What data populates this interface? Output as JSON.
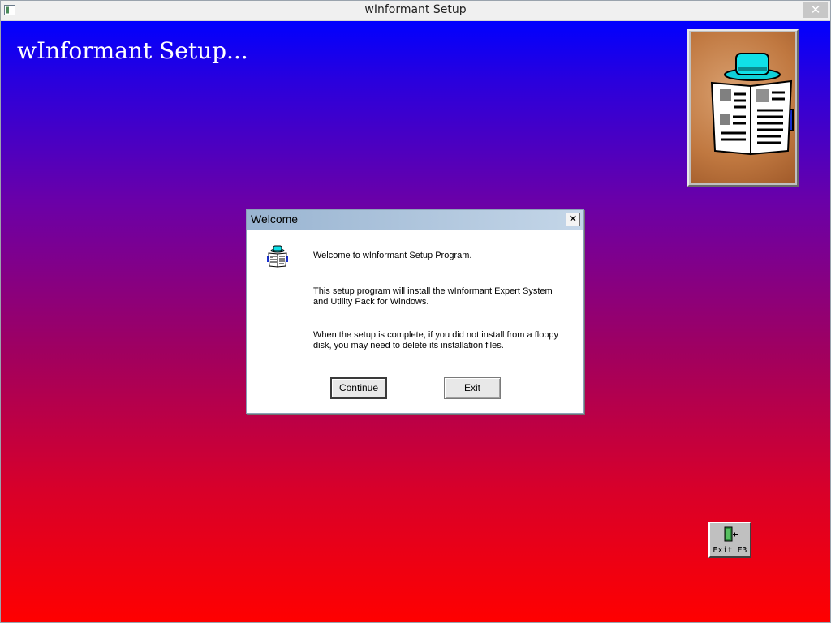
{
  "window": {
    "title": "wInformant Setup",
    "close_label": "✕",
    "app_icon": "window-app-icon"
  },
  "desktop": {
    "heading": "wInformant Setup...",
    "logo": "newspaper-reader-logo",
    "background_top_color": "#0000ff",
    "background_bottom_color": "#ff0000"
  },
  "dialog": {
    "title": "Welcome",
    "close_label": "✕",
    "icon": "newspaper-reader-icon",
    "paragraphs": [
      "Welcome to wInformant Setup Program.",
      "This setup program will install the wInformant Expert System and Utility Pack for Windows.",
      "When the setup is complete, if you did not install from a floppy disk, you may need to delete its installation files."
    ],
    "continue_label": "Continue",
    "exit_label": "Exit"
  },
  "exit_button": {
    "label": "Exit F3",
    "icon": "exit-door-icon"
  }
}
